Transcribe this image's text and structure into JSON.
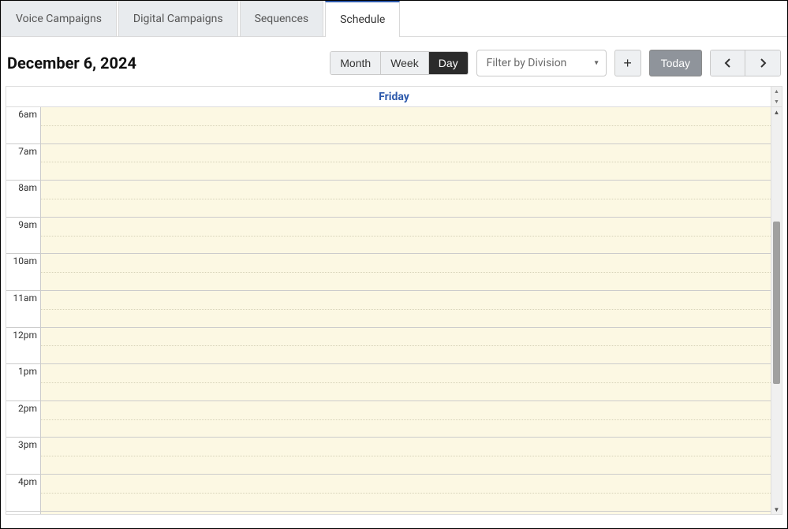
{
  "tabs": [
    {
      "label": "Voice Campaigns",
      "active": false
    },
    {
      "label": "Digital Campaigns",
      "active": false
    },
    {
      "label": "Sequences",
      "active": false
    },
    {
      "label": "Schedule",
      "active": true
    }
  ],
  "toolbar": {
    "date_title": "December 6, 2024",
    "views": {
      "month": "Month",
      "week": "Week",
      "day": "Day",
      "active": "day"
    },
    "filter_placeholder": "Filter by Division",
    "today_label": "Today"
  },
  "calendar": {
    "day_header": "Friday",
    "time_slots": [
      "6am",
      "7am",
      "8am",
      "9am",
      "10am",
      "11am",
      "12pm",
      "1pm",
      "2pm",
      "3pm",
      "4pm"
    ]
  }
}
